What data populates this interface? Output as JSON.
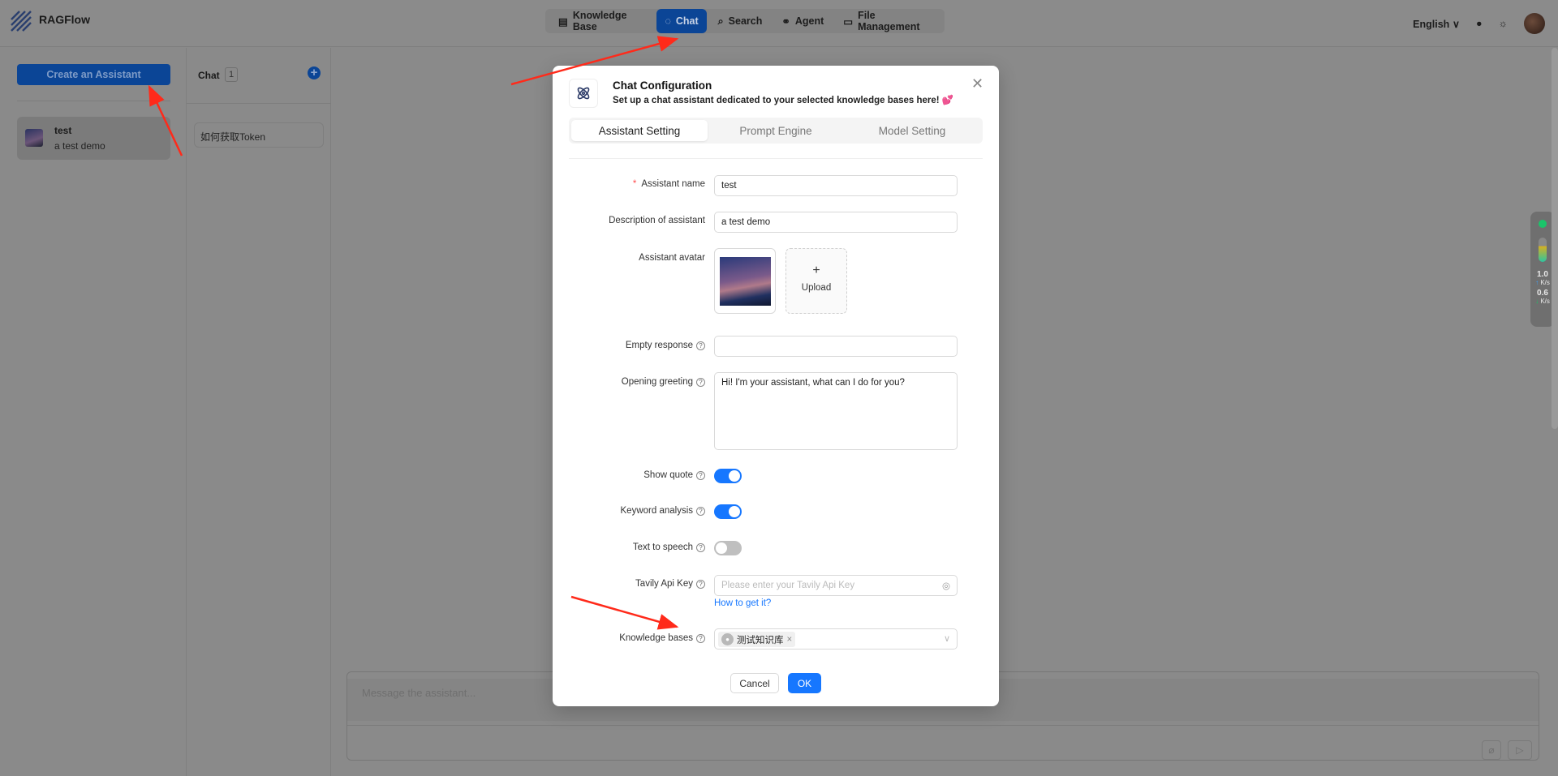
{
  "header": {
    "brand": "RAGFlow",
    "nav": [
      {
        "label": "Knowledge Base",
        "icon": "database-icon"
      },
      {
        "label": "Chat",
        "icon": "chat-icon",
        "active": true
      },
      {
        "label": "Search",
        "icon": "search-icon"
      },
      {
        "label": "Agent",
        "icon": "agent-icon"
      },
      {
        "label": "File Management",
        "icon": "folder-icon"
      }
    ],
    "language": "English"
  },
  "sidebar": {
    "create_label": "Create an Assistant",
    "assistants": [
      {
        "name": "test",
        "description": "a test demo"
      }
    ]
  },
  "chat_list": {
    "title": "Chat",
    "count": "1",
    "items": [
      "如何获取Token"
    ]
  },
  "message": {
    "placeholder": "Message the assistant..."
  },
  "widget": {
    "up": "1.0",
    "up_unit": "K/s",
    "down": "0.6",
    "down_unit": "K/s"
  },
  "modal": {
    "title": "Chat Configuration",
    "subtitle": "Set up a chat assistant dedicated to your selected knowledge bases here! 💕",
    "tabs": [
      "Assistant Setting",
      "Prompt Engine",
      "Model Setting"
    ],
    "active_tab": "Assistant Setting",
    "fields": {
      "name_label": "Assistant name",
      "name_value": "test",
      "desc_label": "Description of assistant",
      "desc_value": "a test demo",
      "avatar_label": "Assistant avatar",
      "upload_label": "Upload",
      "empty_label": "Empty response",
      "empty_value": "",
      "greeting_label": "Opening greeting",
      "greeting_value": "Hi! I'm your assistant, what can I do for you?",
      "quote_label": "Show quote",
      "quote_on": true,
      "keyword_label": "Keyword analysis",
      "keyword_on": true,
      "tts_label": "Text to speech",
      "tts_on": false,
      "tavily_label": "Tavily Api Key",
      "tavily_placeholder": "Please enter your Tavily Api Key",
      "tavily_link": "How to get it?",
      "kb_label": "Knowledge bases",
      "kb_tags": [
        "测试知识库"
      ]
    },
    "cancel": "Cancel",
    "ok": "OK"
  },
  "colors": {
    "primary": "#1677ff",
    "annotation": "#ff2a1a"
  }
}
